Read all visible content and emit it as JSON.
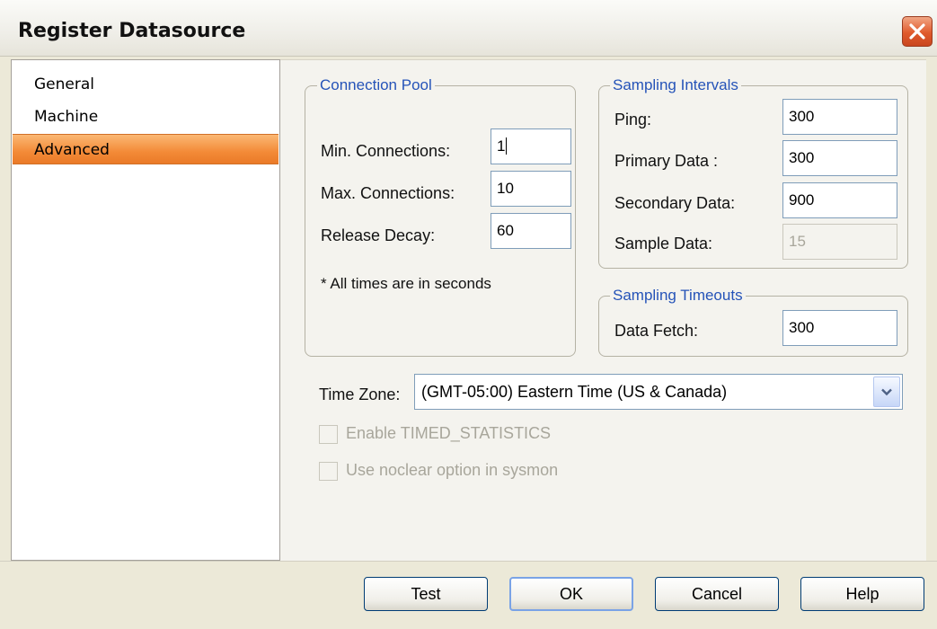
{
  "window": {
    "title": "Register Datasource"
  },
  "nav": {
    "items": [
      "General",
      "Machine",
      "Advanced"
    ],
    "selected": "Advanced"
  },
  "connection_pool": {
    "title": "Connection Pool",
    "min_label": "Min. Connections:",
    "min_value": "1",
    "max_label": "Max. Connections:",
    "max_value": "10",
    "decay_label": "Release Decay:",
    "decay_value": "60",
    "note": "* All times are in seconds"
  },
  "sampling_intervals": {
    "title": "Sampling Intervals",
    "ping_label": "Ping:",
    "ping_value": "300",
    "primary_label": "Primary Data :",
    "primary_value": "300",
    "secondary_label": "Secondary Data:",
    "secondary_value": "900",
    "sample_label": "Sample Data:",
    "sample_value": "15"
  },
  "sampling_timeouts": {
    "title": "Sampling Timeouts",
    "fetch_label": "Data Fetch:",
    "fetch_value": "300"
  },
  "timezone": {
    "label": "Time Zone:",
    "value": "(GMT-05:00) Eastern Time (US & Canada)"
  },
  "options": {
    "timed_statistics": "Enable TIMED_STATISTICS",
    "noclear": "Use noclear option in sysmon"
  },
  "buttons": {
    "test": "Test",
    "ok": "OK",
    "cancel": "Cancel",
    "help": "Help"
  },
  "colors": {
    "selected_nav": "#f38a37",
    "group_title": "#2553b8",
    "close_button": "#e05a2c"
  }
}
